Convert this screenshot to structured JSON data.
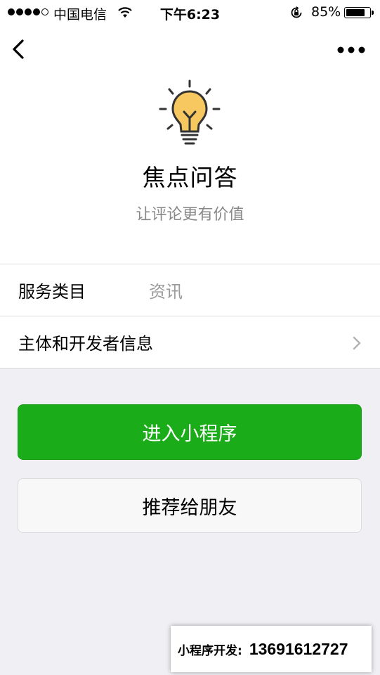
{
  "status_bar": {
    "carrier": "中国电信",
    "time": "下午6:23",
    "battery_percent": "85%",
    "battery_level": 0.85,
    "signal_bars_filled": 4,
    "signal_bars_total": 5
  },
  "nav": {
    "back_icon": "chevron-left-icon",
    "more_icon": "ellipsis-icon"
  },
  "app": {
    "icon": "lightbulb-icon",
    "name": "焦点问答",
    "description": "让评论更有价值"
  },
  "info_rows": {
    "service_category_label": "服务类目",
    "service_category_value": "资讯",
    "developer_info_label": "主体和开发者信息"
  },
  "buttons": {
    "enter": "进入小程序",
    "share": "推荐给朋友"
  },
  "ad_banner": {
    "label": "小程序开发:",
    "phone": "13691612727"
  },
  "colors": {
    "primary_green": "#1aad19",
    "background": "#efeff4",
    "bulb_yellow": "#f6c85f"
  }
}
